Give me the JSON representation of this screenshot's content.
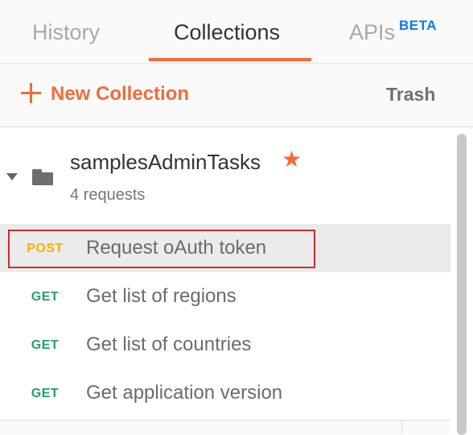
{
  "tabs": {
    "history": "History",
    "collections": "Collections",
    "apis": "APIs",
    "apis_badge": "BETA"
  },
  "toolbar": {
    "new_collection": "New Collection",
    "trash": "Trash"
  },
  "collection": {
    "name": "samplesAdminTasks",
    "count": "4 requests",
    "favorite_icon": "star-icon",
    "folder_icon": "folder-icon"
  },
  "requests": [
    {
      "method": "POST",
      "name": "Request oAuth token"
    },
    {
      "method": "GET",
      "name": "Get list of regions"
    },
    {
      "method": "GET",
      "name": "Get list of countries"
    },
    {
      "method": "GET",
      "name": "Get application version"
    }
  ],
  "colors": {
    "accent": "#f26b3a",
    "beta": "#097bed",
    "post": "#f5b400",
    "get": "#20a36c",
    "highlight": "#d32a2a"
  }
}
